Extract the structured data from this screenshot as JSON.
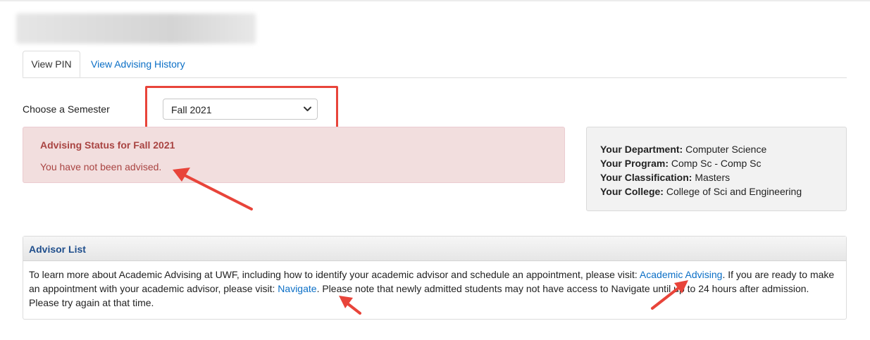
{
  "tabs": {
    "active": "View PIN",
    "history": "View Advising History"
  },
  "semester": {
    "label": "Choose a Semester",
    "selected": "Fall 2021"
  },
  "alert": {
    "title": "Advising Status for Fall 2021",
    "message": "You have not been advised."
  },
  "info": {
    "department_label": "Your Department:",
    "department": "Computer Science",
    "program_label": "Your Program:",
    "program": "Comp Sc - Comp Sc",
    "classification_label": "Your Classification:",
    "classification": "Masters",
    "college_label": "Your College:",
    "college": "College of Sci and Engineering"
  },
  "advisor": {
    "title": "Advisor List",
    "text1": "To learn more about Academic Advising at UWF, including how to identify your academic advisor and schedule an appointment, please visit: ",
    "link1": "Academic Advising",
    "text2": ". If you are ready to make an appointment with your academic advisor, please visit: ",
    "link2": "Navigate",
    "text3": ". Please note that newly admitted students may not have access to Navigate until up to 24 hours after admission. Please try again at that time."
  },
  "colors": {
    "link": "#0b6fc6",
    "alert_text": "#a94442",
    "alert_bg": "#f2dede",
    "annotation": "#e8443a"
  },
  "icons": {
    "select": "chevron-down-icon",
    "annotations": "arrow-icon"
  }
}
